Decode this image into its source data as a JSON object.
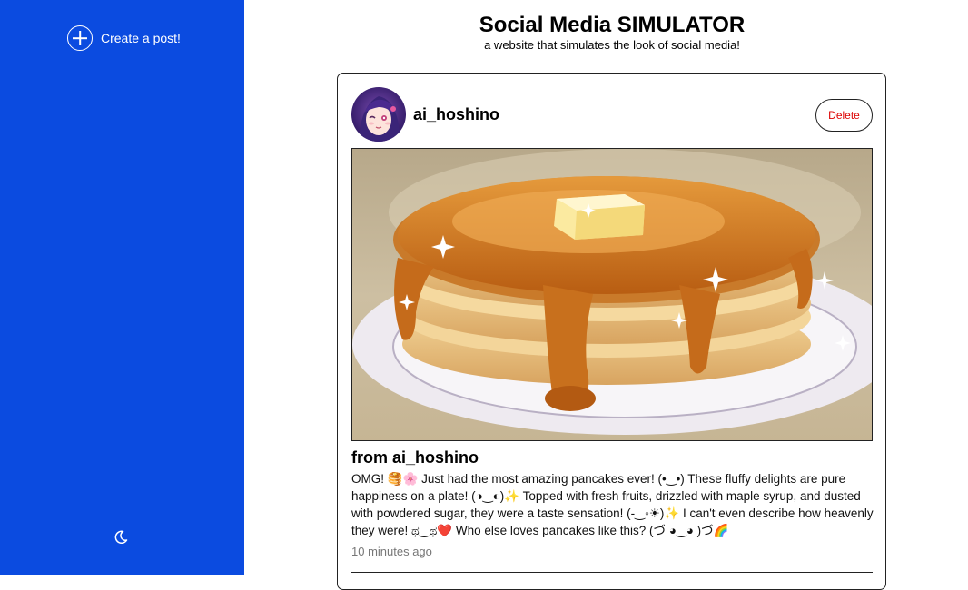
{
  "sidebar": {
    "create_label": "Create a post!",
    "create_icon": "plus-circle-icon",
    "theme_icon": "moon-icon",
    "bg_color": "#0b4be0"
  },
  "header": {
    "title": "Social Media SIMULATOR",
    "subtitle": "a website that simulates the look of social media!"
  },
  "post": {
    "username": "ai_hoshino",
    "delete_label": "Delete",
    "from_label": "from ai_hoshino",
    "text": "OMG! 🥞🌸 Just had the most amazing pancakes ever! (•‿•) These fluffy delights are pure happiness on a plate! (◑‿◐)✨ Topped with fresh fruits, drizzled with maple syrup, and dusted with powdered sugar, they were a taste sensation! (-‿◦☀)✨ I can't even describe how heavenly they were! ಥ‿ಥ❤️ Who else loves pancakes like this? (づ ◕‿◕ )づ🌈",
    "time": "10 minutes ago"
  }
}
